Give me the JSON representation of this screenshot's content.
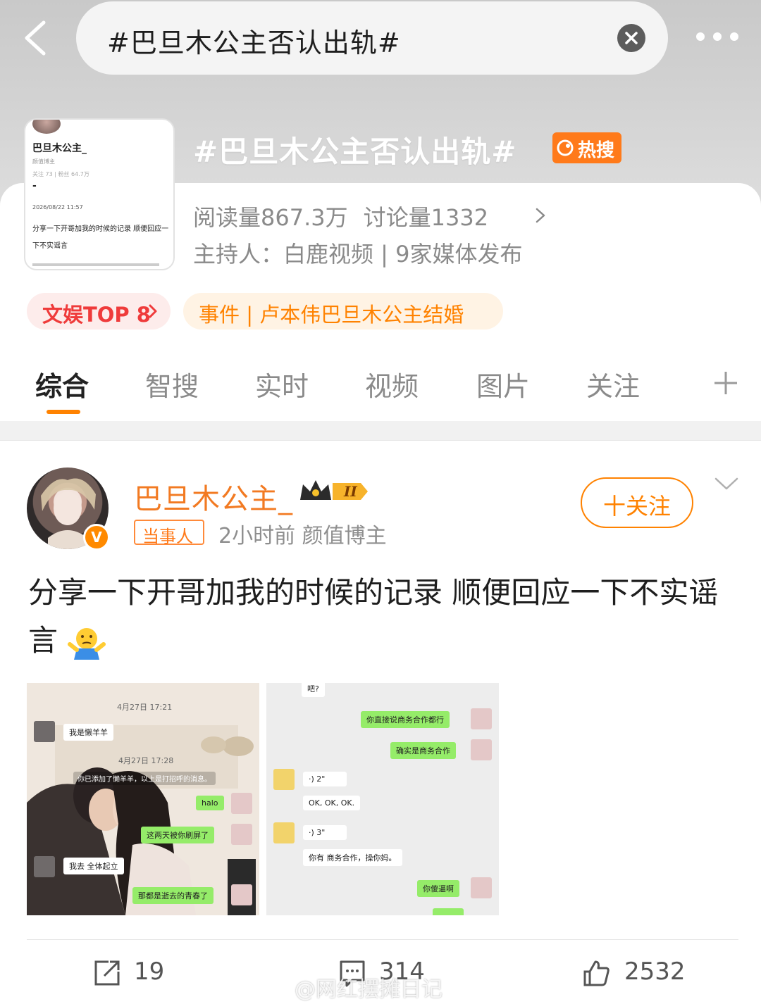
{
  "search": {
    "query": "#巴旦木公主否认出轨#"
  },
  "topic": {
    "title": "#巴旦木公主否认出轨#",
    "badge": "热搜",
    "reads": "阅读量867.3万",
    "discussions": "讨论量1332",
    "host": "主持人：白鹿视频 | 9家媒体发布",
    "thumb": {
      "name": "巴旦木公主_",
      "subtitle": "颜值博主",
      "follow_counts": "关注 73  |  粉丝 64.7万",
      "dash": "-",
      "time": "2026/08/22 11:57",
      "text": "分享一下开哥加我的时候的记录 顺便回应一下不实谣言"
    }
  },
  "tags": {
    "rank": "文娱TOP 8",
    "event": "事件 | 卢本伟巴旦木公主结婚"
  },
  "tabs": [
    "综合",
    "智搜",
    "实时",
    "视频",
    "图片",
    "关注"
  ],
  "post": {
    "author": "巴旦木公主_",
    "role": "当事人",
    "meta": "2小时前  颜值博主",
    "follow_label": "十关注",
    "text": "分享一下开哥加我的时候的记录 顺便回应一下不实谣言",
    "verified_mark": "V",
    "level_mark": "II",
    "image1": {
      "time1": "4月27日 17:21",
      "msg1": "我是懒羊羊",
      "time2": "4月27日 17:28",
      "sys": "你已添加了懒羊羊，以上是打招呼的消息。",
      "msg2": "halo",
      "msg3": "这两天被你刷屏了",
      "msg4": "我去 全体起立",
      "msg5": "那都是逝去的青春了"
    },
    "image2": {
      "msg0": "吧?",
      "msg1": "你直接说商务合作都行",
      "msg2": "确实是商务合作",
      "voice1": "·) 2\"",
      "msg3": "OK, OK, OK.",
      "voice2": "·) 3\"",
      "msg4": "你有  商务合作，操你妈。",
      "msg5": "你傻逼啊"
    }
  },
  "actions": {
    "share": "19",
    "comment": "314",
    "like": "2532"
  },
  "watermark": "@网红摆摊日记",
  "colors": {
    "accent": "#ff8200",
    "name": "#f27a22",
    "hot": "#ff7a1a"
  }
}
